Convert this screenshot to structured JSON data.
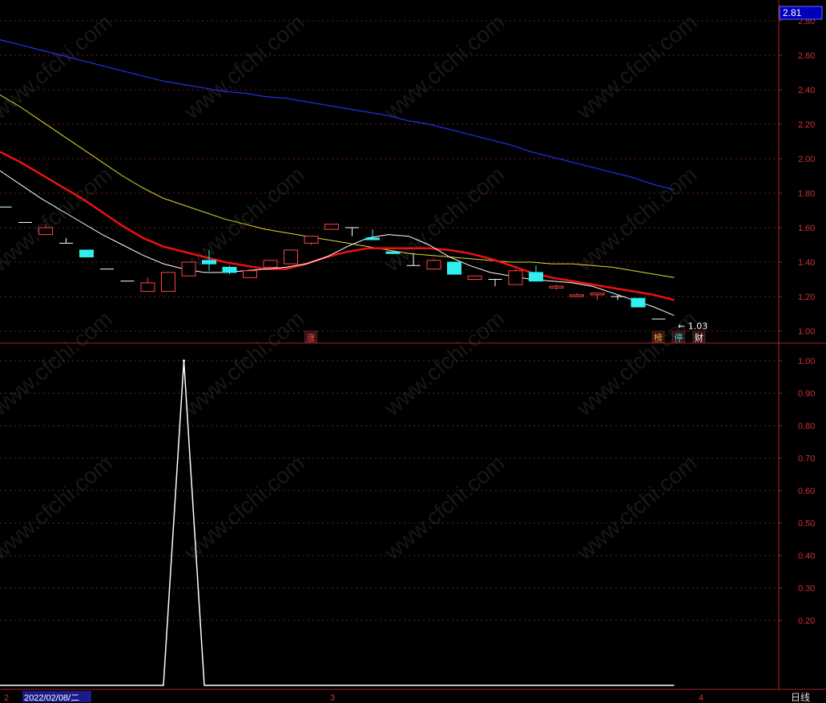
{
  "price_tag": "2.81",
  "period_label": "日线",
  "date_label": "2022/02/08/二",
  "time_markers": [
    "2",
    "3",
    "4"
  ],
  "watermark": "www.cfchi.com",
  "chart_data": [
    {
      "type": "candlestick",
      "y_ticks": [
        "2.80",
        "2.60",
        "2.40",
        "2.20",
        "2.00",
        "1.80",
        "1.60",
        "1.40",
        "1.20",
        "1.00"
      ],
      "ylim": [
        0.93,
        2.83
      ],
      "candles": [
        {
          "o": 1.72,
          "c": 1.72,
          "h": 1.72,
          "l": 1.72
        },
        {
          "o": 1.63,
          "c": 1.63,
          "h": 1.63,
          "l": 1.63
        },
        {
          "o": 1.56,
          "c": 1.6,
          "h": 1.62,
          "l": 1.56
        },
        {
          "o": 1.51,
          "c": 1.51,
          "h": 1.54,
          "l": 1.51
        },
        {
          "o": 1.47,
          "c": 1.43,
          "h": 1.47,
          "l": 1.43
        },
        {
          "o": 1.36,
          "c": 1.36,
          "h": 1.36,
          "l": 1.36
        },
        {
          "o": 1.29,
          "c": 1.29,
          "h": 1.29,
          "l": 1.29
        },
        {
          "o": 1.23,
          "c": 1.28,
          "h": 1.31,
          "l": 1.23
        },
        {
          "o": 1.23,
          "c": 1.34,
          "h": 1.34,
          "l": 1.23
        },
        {
          "o": 1.32,
          "c": 1.4,
          "h": 1.4,
          "l": 1.32
        },
        {
          "o": 1.41,
          "c": 1.39,
          "h": 1.47,
          "l": 1.35
        },
        {
          "o": 1.37,
          "c": 1.34,
          "h": 1.38,
          "l": 1.33
        },
        {
          "o": 1.31,
          "c": 1.35,
          "h": 1.36,
          "l": 1.31
        },
        {
          "o": 1.37,
          "c": 1.41,
          "h": 1.41,
          "l": 1.37
        },
        {
          "o": 1.39,
          "c": 1.47,
          "h": 1.47,
          "l": 1.39
        },
        {
          "o": 1.51,
          "c": 1.55,
          "h": 1.55,
          "l": 1.5
        },
        {
          "o": 1.59,
          "c": 1.62,
          "h": 1.62,
          "l": 1.59
        },
        {
          "o": 1.6,
          "c": 1.6,
          "h": 1.6,
          "l": 1.55
        },
        {
          "o": 1.54,
          "c": 1.53,
          "h": 1.59,
          "l": 1.53
        },
        {
          "o": 1.46,
          "c": 1.45,
          "h": 1.46,
          "l": 1.45
        },
        {
          "o": 1.38,
          "c": 1.38,
          "h": 1.45,
          "l": 1.38
        },
        {
          "o": 1.36,
          "c": 1.41,
          "h": 1.42,
          "l": 1.36
        },
        {
          "o": 1.4,
          "c": 1.33,
          "h": 1.4,
          "l": 1.33
        },
        {
          "o": 1.3,
          "c": 1.32,
          "h": 1.32,
          "l": 1.3
        },
        {
          "o": 1.3,
          "c": 1.3,
          "h": 1.3,
          "l": 1.26
        },
        {
          "o": 1.27,
          "c": 1.35,
          "h": 1.36,
          "l": 1.27
        },
        {
          "o": 1.34,
          "c": 1.29,
          "h": 1.38,
          "l": 1.29
        },
        {
          "o": 1.25,
          "c": 1.26,
          "h": 1.27,
          "l": 1.24
        },
        {
          "o": 1.2,
          "c": 1.21,
          "h": 1.22,
          "l": 1.2
        },
        {
          "o": 1.21,
          "c": 1.22,
          "h": 1.22,
          "l": 1.18
        },
        {
          "o": 1.2,
          "c": 1.2,
          "h": 1.21,
          "l": 1.18
        },
        {
          "o": 1.19,
          "c": 1.14,
          "h": 1.19,
          "l": 1.14
        },
        {
          "o": 1.07,
          "c": 1.07,
          "h": 1.07,
          "l": 1.07
        }
      ],
      "ma_white": [
        1.93,
        1.85,
        1.77,
        1.7,
        1.63,
        1.56,
        1.5,
        1.44,
        1.39,
        1.36,
        1.34,
        1.34,
        1.35,
        1.36,
        1.37,
        1.39,
        1.43,
        1.49,
        1.54,
        1.56,
        1.55,
        1.5,
        1.43,
        1.38,
        1.34,
        1.32,
        1.3,
        1.29,
        1.28,
        1.26,
        1.22,
        1.18,
        1.14,
        1.09
      ],
      "ma_red": [
        2.04,
        1.98,
        1.91,
        1.84,
        1.77,
        1.69,
        1.61,
        1.54,
        1.49,
        1.46,
        1.43,
        1.4,
        1.38,
        1.36,
        1.36,
        1.39,
        1.43,
        1.46,
        1.48,
        1.48,
        1.48,
        1.48,
        1.47,
        1.45,
        1.42,
        1.38,
        1.34,
        1.31,
        1.29,
        1.27,
        1.25,
        1.23,
        1.21,
        1.18
      ],
      "ma_yellow": [
        2.37,
        2.3,
        2.22,
        2.14,
        2.06,
        1.98,
        1.9,
        1.83,
        1.77,
        1.73,
        1.69,
        1.65,
        1.62,
        1.59,
        1.57,
        1.55,
        1.53,
        1.51,
        1.49,
        1.47,
        1.45,
        1.44,
        1.43,
        1.42,
        1.41,
        1.4,
        1.4,
        1.39,
        1.39,
        1.38,
        1.37,
        1.35,
        1.33,
        1.31
      ],
      "ma_blue": [
        2.69,
        2.66,
        2.63,
        2.6,
        2.57,
        2.54,
        2.51,
        2.48,
        2.45,
        2.43,
        2.41,
        2.39,
        2.38,
        2.36,
        2.35,
        2.33,
        2.31,
        2.29,
        2.27,
        2.25,
        2.22,
        2.2,
        2.17,
        2.14,
        2.11,
        2.08,
        2.04,
        2.01,
        1.98,
        1.95,
        1.92,
        1.89,
        1.85,
        1.82
      ],
      "low_marker": "1.03",
      "badges": [
        {
          "index": 15,
          "text": "涨",
          "color": "#ff5555"
        },
        {
          "index": 32,
          "text": "榜",
          "color": "#ffaa33"
        },
        {
          "index": 33,
          "text": "停",
          "color": "#33dddd"
        },
        {
          "index": 34,
          "text": "财",
          "color": "#ffffff"
        }
      ]
    },
    {
      "type": "line",
      "y_ticks": [
        "1.00",
        "0.90",
        "0.80",
        "0.70",
        "0.60",
        "0.50",
        "0.40",
        "0.30",
        "0.20"
      ],
      "ylim": [
        0.0,
        1.0
      ],
      "values": [
        0,
        0,
        0,
        0,
        0,
        0,
        0,
        0,
        0,
        1.0,
        0,
        0,
        0,
        0,
        0,
        0,
        0,
        0,
        0,
        0,
        0,
        0,
        0,
        0,
        0,
        0,
        0,
        0,
        0,
        0,
        0,
        0,
        0,
        0
      ]
    }
  ]
}
